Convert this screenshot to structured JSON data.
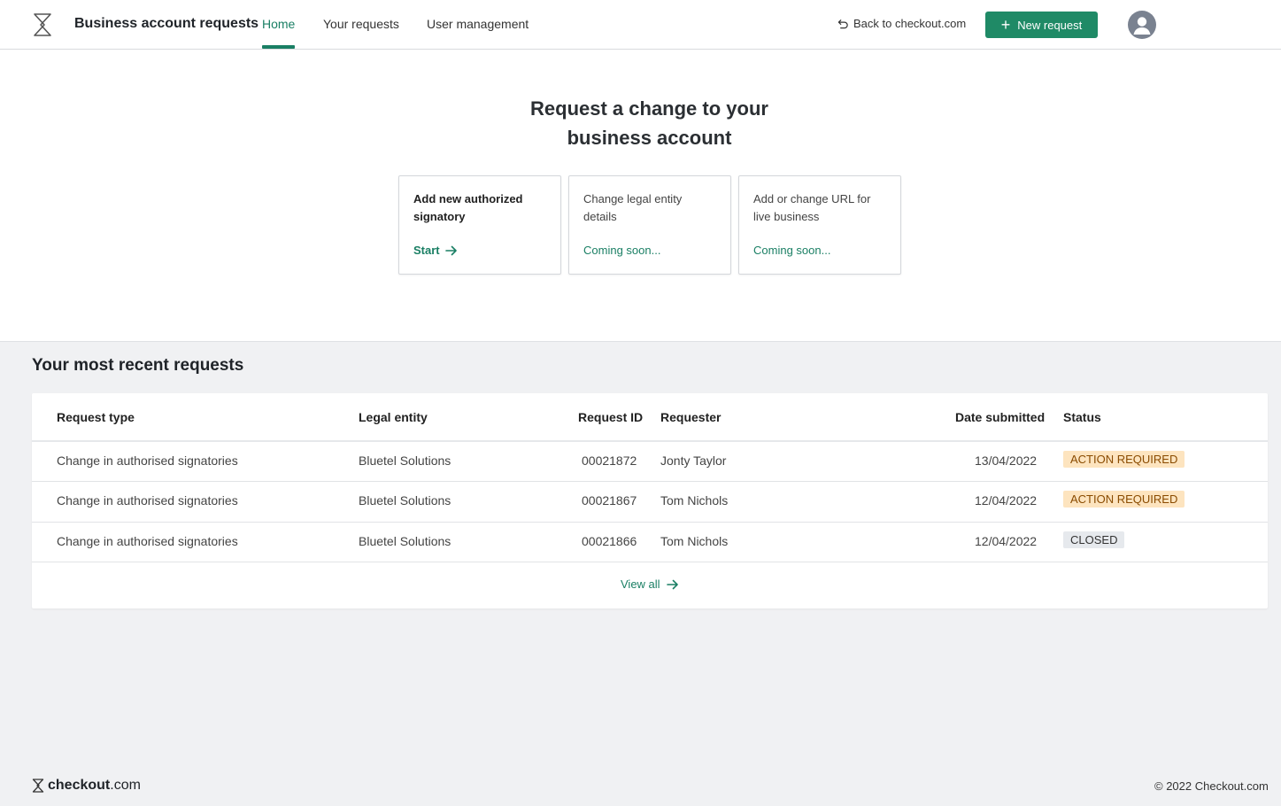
{
  "header": {
    "app_title": "Business account requests",
    "tabs": [
      {
        "label": "Home",
        "active": true
      },
      {
        "label": "Your requests",
        "active": false
      },
      {
        "label": "User management",
        "active": false
      }
    ],
    "back_label": "Back to checkout.com",
    "new_request_label": "New request",
    "accent_color": "#1a7f64",
    "button_color": "#1f8a66"
  },
  "hero": {
    "title_line1": "Request a change to your",
    "title_line2": "business account",
    "cards": [
      {
        "title": "Add new authorized signatory",
        "action": "Start",
        "enabled": true
      },
      {
        "title": "Change legal entity details",
        "action": "Coming soon...",
        "enabled": false
      },
      {
        "title": "Add or change URL for live business",
        "action": "Coming soon...",
        "enabled": false
      }
    ]
  },
  "recent": {
    "heading": "Your most recent requests",
    "columns": [
      "Request type",
      "Legal entity",
      "Request ID",
      "Requester",
      "Date submitted",
      "Status"
    ],
    "rows": [
      {
        "type": "Change in authorised signatories",
        "entity": "Bluetel Solutions",
        "id": "00021872",
        "requester": "Jonty Taylor",
        "date": "13/04/2022",
        "status": "ACTION REQUIRED"
      },
      {
        "type": "Change in authorised signatories",
        "entity": "Bluetel Solutions",
        "id": "00021867",
        "requester": "Tom Nichols",
        "date": "12/04/2022",
        "status": "ACTION REQUIRED"
      },
      {
        "type": "Change in authorised signatories",
        "entity": "Bluetel Solutions",
        "id": "00021866",
        "requester": "Tom Nichols",
        "date": "12/04/2022",
        "status": "CLOSED"
      }
    ],
    "view_all_label": "View all",
    "status_colors": {
      "action_bg": "#fde4bf",
      "action_text": "#8a4b00",
      "closed_bg": "#e6e9ed"
    }
  },
  "footer": {
    "brand_bold": "checkout",
    "brand_light": ".com",
    "copyright": "© 2022 Checkout.com"
  }
}
